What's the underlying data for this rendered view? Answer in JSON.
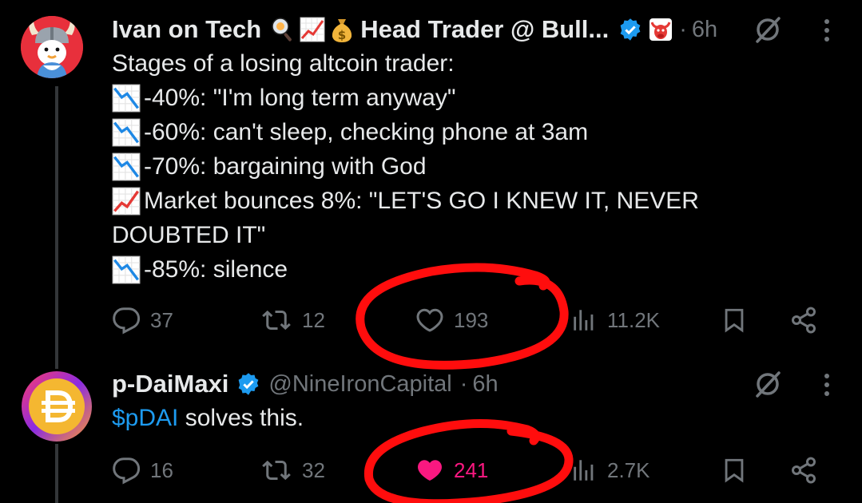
{
  "colors": {
    "accent": "#1d9bf0",
    "like": "#f91880",
    "muted": "#71767b",
    "annotation": "#ff0d0d"
  },
  "tweets": [
    {
      "author_name": "Ivan on Tech",
      "author_suffix": "Head Trader @ Bull...",
      "emoji_icons": [
        "magnifier-icon",
        "chart-up-icon",
        "money-bag-icon"
      ],
      "dot": "·",
      "time": "6h",
      "lines": [
        {
          "icon": "",
          "text": "Stages of a losing altcoin trader:"
        },
        {
          "icon": "chart-down-icon",
          "text": "-40%: \"I'm long term anyway\""
        },
        {
          "icon": "chart-down-icon",
          "text": "-60%: can't sleep, checking phone at 3am"
        },
        {
          "icon": "chart-down-icon",
          "text": "-70%: bargaining with God"
        },
        {
          "icon": "chart-up-icon",
          "text": "Market bounces 8%: \"LET'S GO I KNEW IT, NEVER"
        },
        {
          "icon": "",
          "text": "DOUBTED IT\""
        },
        {
          "icon": "chart-down-icon",
          "text": "-85%: silence"
        }
      ],
      "actions": {
        "replies": "37",
        "reposts": "12",
        "likes": "193",
        "views": "11.2K"
      }
    },
    {
      "author_name": "p-DaiMaxi",
      "handle": "@NineIronCapital",
      "dot": "·",
      "time": "6h",
      "mention": "$pDAI",
      "text": " solves this.",
      "actions": {
        "replies": "16",
        "reposts": "32",
        "likes": "241",
        "views": "2.7K"
      }
    }
  ]
}
